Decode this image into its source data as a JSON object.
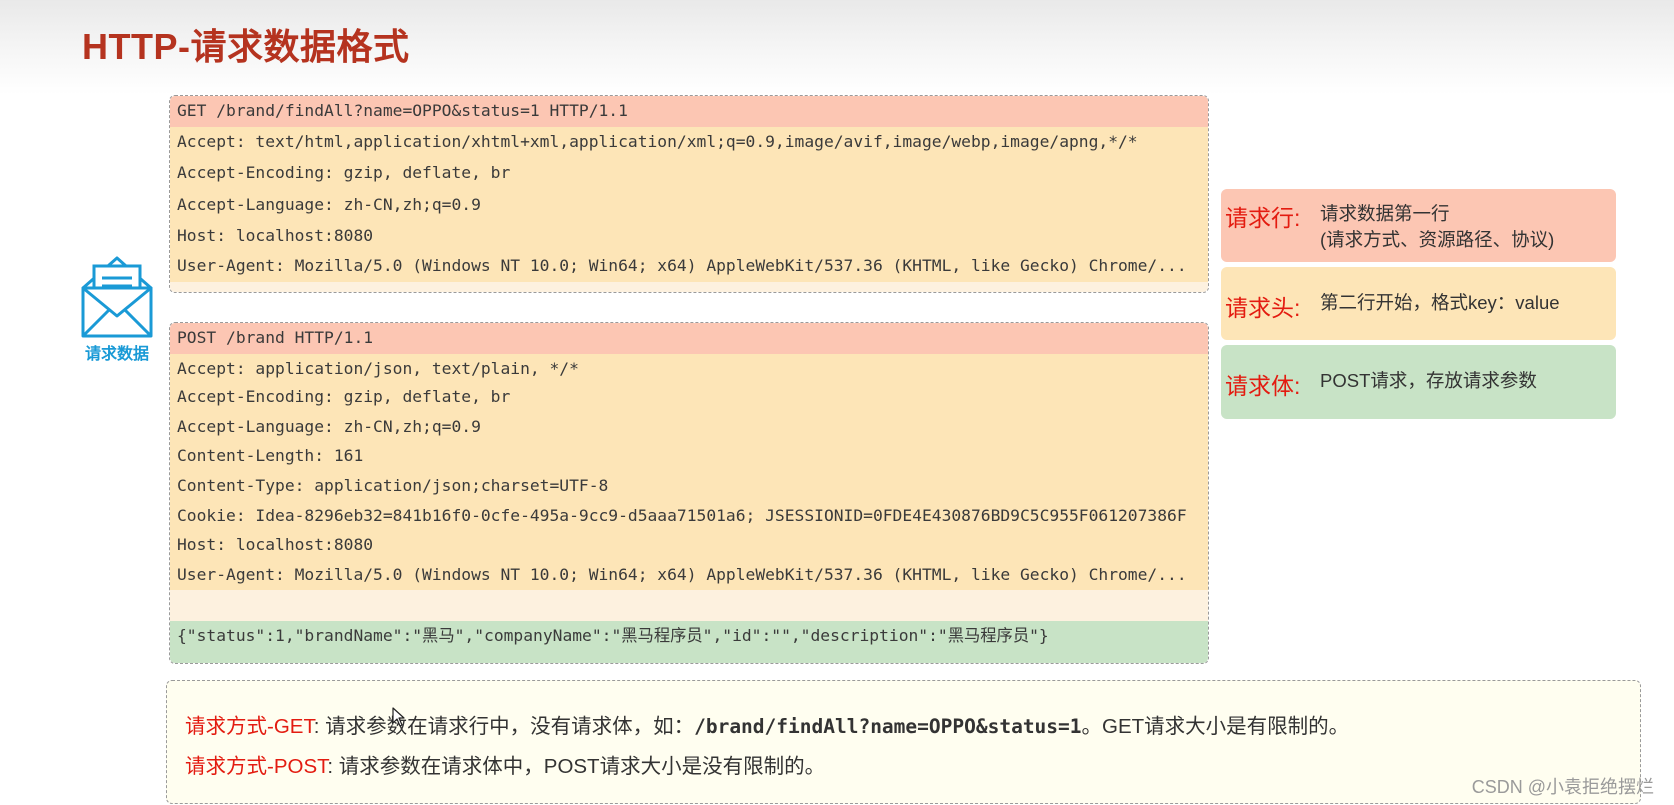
{
  "slide": {
    "title": "HTTP-请求数据格式"
  },
  "envelope": {
    "icon": "envelope-icon",
    "label": "请求数据",
    "color": "#1a9ad6"
  },
  "get_request": {
    "request_line": "GET /brand/findAll?name=OPPO&status=1 HTTP/1.1",
    "headers": [
      "Accept: text/html,application/xhtml+xml,application/xml;q=0.9,image/avif,image/webp,image/apng,*/*",
      "Accept-Encoding: gzip, deflate, br",
      "Accept-Language: zh-CN,zh;q=0.9",
      "Host: localhost:8080",
      "User-Agent: Mozilla/5.0 (Windows NT 10.0; Win64; x64) AppleWebKit/537.36 (KHTML, like Gecko) Chrome/..."
    ]
  },
  "post_request": {
    "request_line": "POST /brand HTTP/1.1",
    "headers": [
      "Accept: application/json, text/plain, */*",
      "Accept-Encoding: gzip, deflate, br",
      "Accept-Language: zh-CN,zh;q=0.9",
      "Content-Length: 161",
      "Content-Type: application/json;charset=UTF-8",
      "Cookie: Idea-8296eb32=841b16f0-0cfe-495a-9cc9-d5aaa71501a6; JSESSIONID=0FDE4E430876BD9C5C955F061207386F",
      "Host: localhost:8080",
      "User-Agent: Mozilla/5.0 (Windows NT 10.0; Win64; x64) AppleWebKit/537.36 (KHTML, like Gecko) Chrome/..."
    ],
    "body": "{\"status\":1,\"brandName\":\"黑马\",\"companyName\":\"黑马程序员\",\"id\":\"\",\"description\":\"黑马程序员\"}"
  },
  "legend": {
    "request_line": {
      "term": "请求行:",
      "desc_line1": "请求数据第一行",
      "desc_line2": "(请求方式、资源路径、协议)"
    },
    "request_header": {
      "term": "请求头:",
      "desc": "第二行开始，格式key：value"
    },
    "request_body": {
      "term": "请求体:",
      "desc": "POST请求，存放请求参数"
    }
  },
  "notes": {
    "get": {
      "term": "请求方式-GET",
      "text_before": ": 请求参数在请求行中，没有请求体，如：",
      "code": "/brand/findAll?name=OPPO&status=1",
      "text_after": "。GET请求大小是有限制的。"
    },
    "post": {
      "term": "请求方式-POST",
      "text": ": 请求参数在请求体中，POST请求大小是没有限制的。"
    }
  },
  "watermark": "CSDN @小袁拒绝摆烂",
  "colors": {
    "title": "#b5331f",
    "request_line_bg": "#fcc6b3",
    "request_header_bg": "#fde5b7",
    "request_body_bg": "#c8e3c6",
    "accent_red": "#e31b10"
  }
}
